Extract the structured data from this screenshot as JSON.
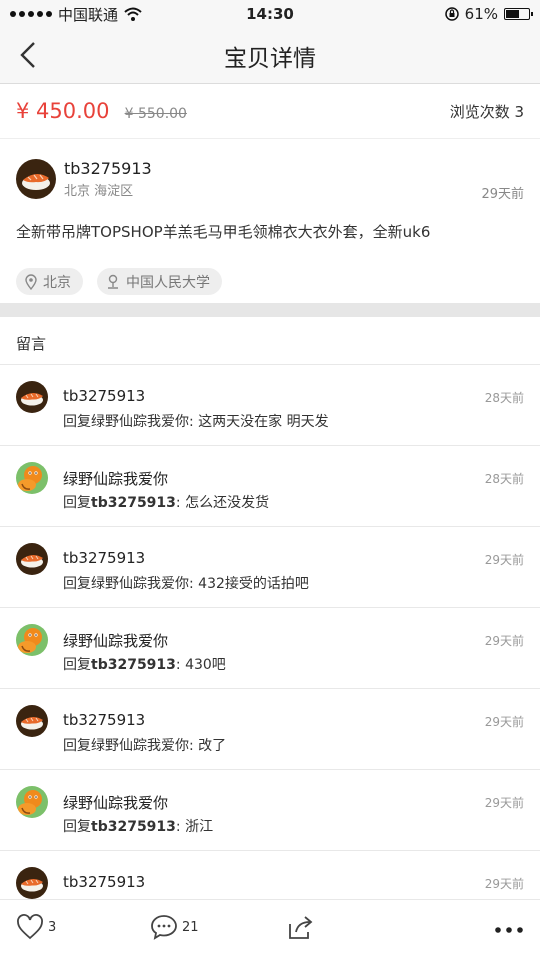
{
  "status_bar": {
    "carrier": "中国联通",
    "time": "14:30",
    "battery": "61%",
    "battery_level": 0.61
  },
  "nav": {
    "title": "宝贝详情"
  },
  "product": {
    "price": "¥ 450.00",
    "original_price": "¥ 550.00",
    "views_label": "浏览次数 3"
  },
  "seller": {
    "name": "tb3275913",
    "location": "北京 海淀区",
    "time": "29天前"
  },
  "description": "全新带吊牌TOPSHOP羊羔毛马甲毛领棉衣大衣外套，全新uk6",
  "tags": {
    "city": "北京",
    "school": "中国人民大学"
  },
  "comments_title": "留言",
  "comments": [
    {
      "user": "tb3275913",
      "avatar": "sushi",
      "reply_prefix": "回复",
      "reply_to": "绿野仙踪我爱你",
      "reply_to_bold": false,
      "text": ": 这两天没在家 明天发",
      "time": "28天前"
    },
    {
      "user": "绿野仙踪我爱你",
      "avatar": "orange",
      "reply_prefix": "回复",
      "reply_to": "tb3275913",
      "reply_to_bold": true,
      "text": ": 怎么还没发货",
      "time": "28天前"
    },
    {
      "user": "tb3275913",
      "avatar": "sushi",
      "reply_prefix": "回复",
      "reply_to": "绿野仙踪我爱你",
      "reply_to_bold": false,
      "text": ": 432接受的话拍吧",
      "time": "29天前"
    },
    {
      "user": "绿野仙踪我爱你",
      "avatar": "orange",
      "reply_prefix": "回复",
      "reply_to": "tb3275913",
      "reply_to_bold": true,
      "text": ": 430吧",
      "time": "29天前"
    },
    {
      "user": "tb3275913",
      "avatar": "sushi",
      "reply_prefix": "回复",
      "reply_to": "绿野仙踪我爱你",
      "reply_to_bold": false,
      "text": ": 改了",
      "time": "29天前"
    },
    {
      "user": "绿野仙踪我爱你",
      "avatar": "orange",
      "reply_prefix": "回复",
      "reply_to": "tb3275913",
      "reply_to_bold": true,
      "text": ": 浙江",
      "time": "29天前"
    },
    {
      "user": "tb3275913",
      "avatar": "sushi",
      "reply_prefix": "",
      "reply_to": "",
      "reply_to_bold": false,
      "text": "",
      "time": "29天前"
    }
  ],
  "bottom_bar": {
    "likes": "3",
    "comments": "21"
  },
  "colors": {
    "price": "#e8423a",
    "divider": "#e6e6e6"
  }
}
